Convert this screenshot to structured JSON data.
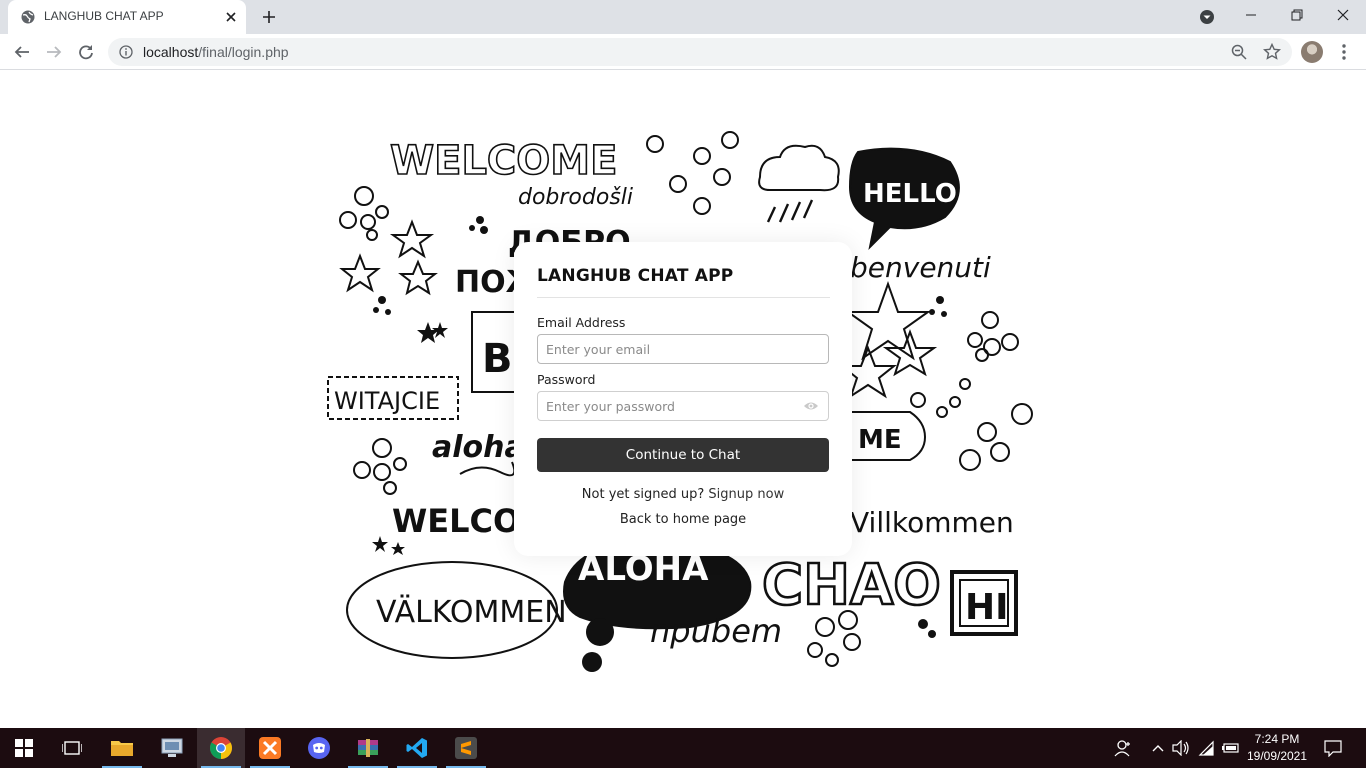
{
  "browser": {
    "tab_title": "LANGHUB CHAT APP",
    "url_host": "localhost",
    "url_path": "/final/login.php"
  },
  "page": {
    "card": {
      "title": "LANGHUB CHAT APP",
      "email_label": "Email Address",
      "email_placeholder": "Enter your email",
      "password_label": "Password",
      "password_placeholder": "Enter your password",
      "submit_label": "Continue to Chat",
      "signup_prompt": "Not yet signed up?",
      "signup_link": "Signup now",
      "back_link": "Back to home page"
    },
    "doodle_words": {
      "welcome_top": "WELCOME",
      "dobrodosli": "dobrodošli",
      "hello": "HELLO",
      "dobro": "ДОБРО",
      "pozh": "ПОЖ",
      "benvenuti": "benvenuti",
      "witajcie": "WITAJCIE",
      "bi": "BI",
      "aloha_small": "aloha",
      "welcome_mid": "WELCOM",
      "me": "ME",
      "villkommen": "Villkommen",
      "valkommen": "VÄLKOMMEN",
      "aloha_big": "ALOHA",
      "chao": "CHAO",
      "hi": "HI",
      "privet": "npubem"
    }
  },
  "taskbar": {
    "time": "7:24 PM",
    "date": "19/09/2021"
  },
  "colors": {
    "button_dark": "#333333",
    "taskbar": "#1c0c10",
    "tabstrip": "#dee1e6"
  }
}
